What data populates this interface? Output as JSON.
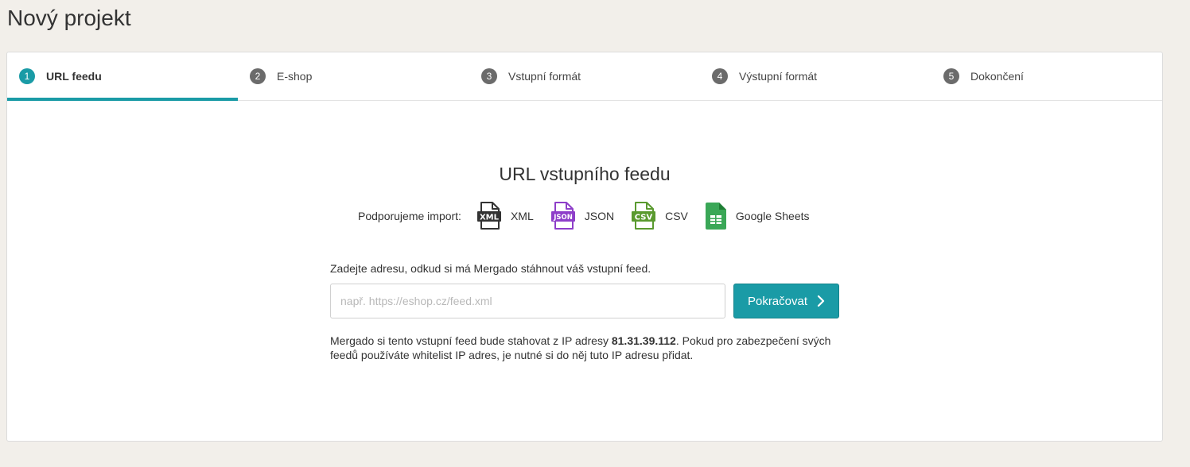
{
  "page": {
    "title": "Nový projekt"
  },
  "steps": [
    {
      "number": "1",
      "label": "URL feedu",
      "active": true
    },
    {
      "number": "2",
      "label": "E-shop",
      "active": false
    },
    {
      "number": "3",
      "label": "Vstupní formát",
      "active": false
    },
    {
      "number": "4",
      "label": "Výstupní formát",
      "active": false
    },
    {
      "number": "5",
      "label": "Dokončení",
      "active": false
    }
  ],
  "main": {
    "title": "URL vstupního feedu",
    "supported_label": "Podporujeme import:",
    "formats": [
      {
        "name": "XML",
        "icon": "xml-file-icon",
        "icon_text": "XML",
        "color": "#333333"
      },
      {
        "name": "JSON",
        "icon": "json-file-icon",
        "icon_text": "JSON",
        "color": "#8e3ec9"
      },
      {
        "name": "CSV",
        "icon": "csv-file-icon",
        "icon_text": "CSV",
        "color": "#5a9a2f"
      },
      {
        "name": "Google Sheets",
        "icon": "google-sheets-icon",
        "color": "#3aa757"
      }
    ],
    "instructions": "Zadejte adresu, odkud si má Mergado stáhnout váš vstupní feed.",
    "url_input": {
      "value": "",
      "placeholder": "např. https://eshop.cz/feed.xml"
    },
    "continue_label": "Pokračovat",
    "note": {
      "before_ip": "Mergado si tento vstupní feed bude stahovat z IP adresy ",
      "ip": "81.31.39.112",
      "after_ip": ". Pokud pro zabezpečení svých feedů používáte whitelist IP adres, je nutné si do něj tuto IP adresu přidat."
    }
  },
  "colors": {
    "accent": "#1a9ba6",
    "background": "#f2efea"
  }
}
